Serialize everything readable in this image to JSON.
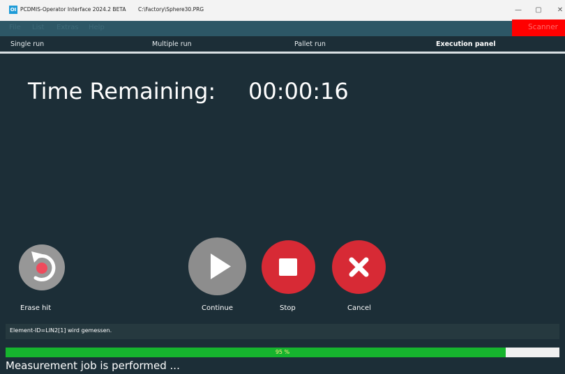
{
  "window": {
    "app_icon_text": "OI",
    "title": "PCDMIS-Operator Interface 2024.2 BETA",
    "file_path": "C:\\Factory\\Sphere30.PRG",
    "minimize_glyph": "—",
    "maximize_glyph": "▢",
    "close_glyph": "✕"
  },
  "menu": {
    "items": [
      "File",
      "List",
      "Extras",
      "Help"
    ],
    "scanner_label": "Scanner",
    "scanner_color": "#ff0000"
  },
  "tabs": [
    {
      "label": "Single run",
      "active": false
    },
    {
      "label": "Multiple run",
      "active": false
    },
    {
      "label": "Pallet run",
      "active": false
    },
    {
      "label": "Execution panel",
      "active": true
    }
  ],
  "panel": {
    "time_label": "Time Remaining:",
    "time_value": "00:00:16"
  },
  "buttons": {
    "erase_hit": {
      "label": "Erase hit",
      "icon": "undo-icon"
    },
    "continue": {
      "label": "Continue",
      "icon": "play-icon"
    },
    "stop": {
      "label": "Stop",
      "icon": "stop-icon"
    },
    "cancel": {
      "label": "Cancel",
      "icon": "close-x-icon"
    }
  },
  "status": {
    "element_message": "Element-ID=LIN2[1] wird gemessen."
  },
  "progress": {
    "percent": 0.903,
    "text": "95 %"
  },
  "footer": {
    "message": "Measurement job is performed ..."
  },
  "colors": {
    "background": "#1c2e37",
    "menubar": "#2d5766",
    "accent_red": "#d72a35",
    "progress_green": "#16b42e"
  }
}
